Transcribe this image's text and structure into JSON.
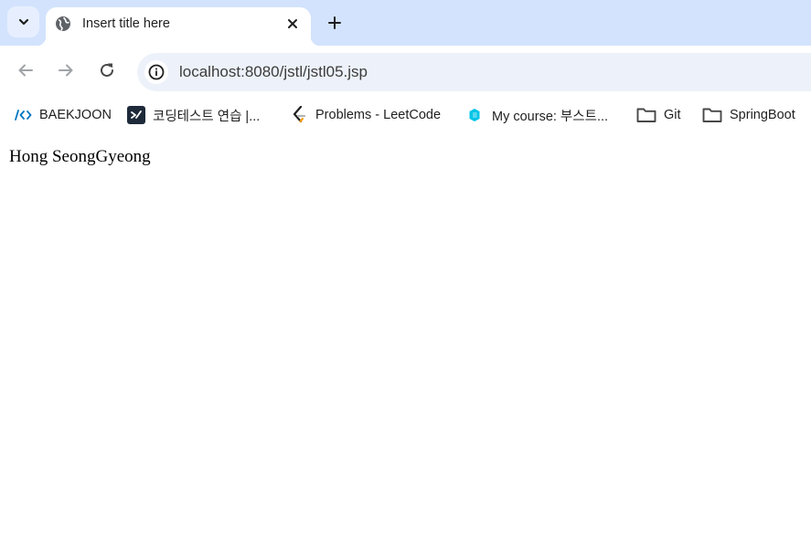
{
  "tab": {
    "title": "Insert title here"
  },
  "omnibox": {
    "url": "localhost:8080/jstl/jstl05.jsp"
  },
  "bookmarks": [
    {
      "label": "BAEKJOON",
      "icon": "baekjoon-icon"
    },
    {
      "label": "코딩테스트 연습 |...",
      "icon": "programmers-icon"
    },
    {
      "label": "Problems - LeetCode",
      "icon": "leetcode-icon"
    },
    {
      "label": "My course: 부스트...",
      "icon": "boostcourse-icon"
    },
    {
      "label": "Git",
      "icon": "folder-icon"
    },
    {
      "label": "SpringBoot",
      "icon": "folder-icon"
    }
  ],
  "page": {
    "text": "Hong SeongGyeong"
  },
  "colors": {
    "tabstrip": "#d3e3fd",
    "omnibox": "#edf2fa",
    "icon": "#474747"
  }
}
